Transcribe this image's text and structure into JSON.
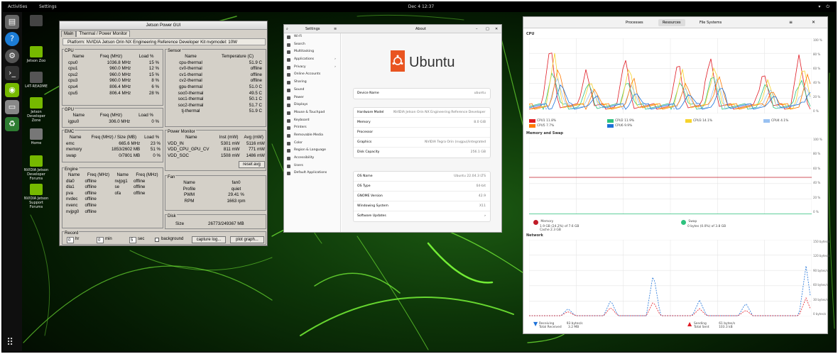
{
  "topbar": {
    "activities": "Activities",
    "app_name": "Settings",
    "clock": "Dec 4 12:37",
    "tray": "▾ ⏻"
  },
  "dock": {
    "items": [
      {
        "name": "files-icon",
        "color": "#666"
      },
      {
        "name": "help-icon",
        "color": "#1c7cd6"
      },
      {
        "name": "settings-icon",
        "color": "#555"
      },
      {
        "name": "terminal-icon",
        "color": "#333"
      },
      {
        "name": "nvidia-icon",
        "color": "#76b900"
      },
      {
        "name": "disk-icon",
        "color": "#888"
      },
      {
        "name": "trash-icon",
        "color": "#2e7d32"
      }
    ]
  },
  "desktop_icons": [
    {
      "label": "Jetson Zoo"
    },
    {
      "label": "L4T-README"
    },
    {
      "label": "Jetson Developer Zone"
    },
    {
      "label": "Home"
    },
    {
      "label": "NVIDIA Jetson Developer Forums"
    },
    {
      "label": "NVIDIA Jetson Support Forums"
    }
  ],
  "jpg": {
    "title": "Jetson Power GUI",
    "tabs": [
      "Main",
      "Thermal / Power Monitor"
    ],
    "platform": "Platform: NVIDIA Jetson Orin NX Engineering Reference Developer Kit     nvpmodel: 10W",
    "cpu": {
      "title": "CPU",
      "headers": [
        "Name",
        "Freq (MHz)",
        "Load %"
      ],
      "rows": [
        [
          "cpu0",
          "1036.8 MHz",
          "15 %"
        ],
        [
          "cpu1",
          "960.0 MHz",
          "12 %"
        ],
        [
          "cpu2",
          "960.0 MHz",
          "15 %"
        ],
        [
          "cpu3",
          "960.0 MHz",
          "8 %"
        ],
        [
          "cpu4",
          "806.4 MHz",
          "6 %"
        ],
        [
          "cpu5",
          "806.4 MHz",
          "28 %"
        ]
      ]
    },
    "gpu": {
      "title": "GPU",
      "headers": [
        "Name",
        "Freq (MHz)",
        "Load %"
      ],
      "rows": [
        [
          "igpu0",
          "306.0 MHz",
          "0 %"
        ]
      ]
    },
    "emc": {
      "title": "EMC",
      "headers": [
        "Name",
        "Freq (MHz) / Size (MB)",
        "Load %"
      ],
      "rows": [
        [
          "emc",
          "665.6 MHz",
          "23 %"
        ],
        [
          "memory",
          "1853/2602 MB",
          "51 %"
        ],
        [
          "swap",
          "0/7801 MB",
          "0 %"
        ]
      ]
    },
    "engine": {
      "title": "Engine",
      "headers": [
        "Name",
        "Freq (MHz)",
        "Name",
        "Freq (MHz)"
      ],
      "rows": [
        [
          "dla0",
          "offline",
          "nvjpg1",
          "offline"
        ],
        [
          "dla1",
          "offline",
          "se",
          "offline"
        ],
        [
          "pva",
          "offline",
          "ofa",
          "offline"
        ],
        [
          "nvdec",
          "offline",
          "",
          ""
        ],
        [
          "nvenc",
          "offline",
          "",
          ""
        ],
        [
          "nvjpg0",
          "offline",
          "",
          ""
        ]
      ]
    },
    "sensor": {
      "title": "Sensor",
      "headers": [
        "Name",
        "Temperature (C)"
      ],
      "rows": [
        [
          "cpu-thermal",
          "51.9 C"
        ],
        [
          "cv0-thermal",
          "offline"
        ],
        [
          "cv1-thermal",
          "offline"
        ],
        [
          "cv2-thermal",
          "offline"
        ],
        [
          "gpu-thermal",
          "51.0 C"
        ],
        [
          "soc0-thermal",
          "49.5 C"
        ],
        [
          "soc1-thermal",
          "50.1 C"
        ],
        [
          "soc2-thermal",
          "51.7 C"
        ],
        [
          "tj-thermal",
          "51.9 C"
        ]
      ]
    },
    "power": {
      "title": "Power Monitor",
      "headers": [
        "Name",
        "Inst (mW)",
        "Avg (mW)"
      ],
      "rows": [
        [
          "VDD_IN",
          "5301 mW",
          "5116 mW"
        ],
        [
          "VDD_CPU_GPU_CV",
          "811 mW",
          "771 mW"
        ],
        [
          "VDD_SOC",
          "1508 mW",
          "1486 mW"
        ]
      ],
      "reset": "reset avg"
    },
    "fan": {
      "title": "Fan",
      "headers": [
        "Name",
        "fan0"
      ],
      "rows": [
        [
          "Profile",
          "quiet"
        ],
        [
          "PWM",
          "29.41 %"
        ],
        [
          "RPM",
          "1663 rpm"
        ]
      ]
    },
    "disk": {
      "title": "Disk",
      "label": "Size",
      "value": "26773/249367 MB"
    },
    "record": {
      "title": "Record",
      "hr": "0",
      "hr_label": "hr",
      "min": "0",
      "min_label": "min",
      "sec": "5",
      "sec_label": "sec",
      "background": "background",
      "capture": "capture log...",
      "plot": "plot graph..."
    }
  },
  "settings": {
    "title": "Settings",
    "page_title": "About",
    "sidebar": [
      {
        "label": "Wi-Fi",
        "icon": "wifi-icon"
      },
      {
        "label": "Search",
        "icon": "search-icon"
      },
      {
        "label": "Multitasking",
        "icon": "multitasking-icon"
      },
      {
        "label": "Applications",
        "icon": "applications-icon"
      },
      {
        "label": "Privacy",
        "icon": "privacy-icon"
      },
      {
        "label": "Online Accounts",
        "icon": "online-accounts-icon"
      },
      {
        "label": "Sharing",
        "icon": "sharing-icon"
      },
      {
        "label": "Sound",
        "icon": "sound-icon"
      },
      {
        "label": "Power",
        "icon": "power-icon"
      },
      {
        "label": "Displays",
        "icon": "displays-icon"
      },
      {
        "label": "Mouse & Touchpad",
        "icon": "mouse-icon"
      },
      {
        "label": "Keyboard",
        "icon": "keyboard-icon"
      },
      {
        "label": "Printers",
        "icon": "printer-icon"
      },
      {
        "label": "Removable Media",
        "icon": "removable-media-icon"
      },
      {
        "label": "Color",
        "icon": "color-icon"
      },
      {
        "label": "Region & Language",
        "icon": "region-icon"
      },
      {
        "label": "Accessibility",
        "icon": "accessibility-icon"
      },
      {
        "label": "Users",
        "icon": "users-icon"
      },
      {
        "label": "Default Applications",
        "icon": "default-apps-icon"
      }
    ],
    "logo_text": "Ubuntu",
    "device_name": {
      "label": "Device Name",
      "value": "ubuntu"
    },
    "hardware": [
      {
        "label": "Hardware Model",
        "value": "NVIDIA Jetson Orin NX Engineering Reference Developer Kit"
      },
      {
        "label": "Memory",
        "value": "8.0 GiB"
      },
      {
        "label": "Processor",
        "value": ""
      },
      {
        "label": "Graphics",
        "value": "NVIDIA Tegra Orin (nvgpu)/integrated"
      },
      {
        "label": "Disk Capacity",
        "value": "256.1 GB"
      }
    ],
    "os": [
      {
        "label": "OS Name",
        "value": "Ubuntu 22.04.3 LTS"
      },
      {
        "label": "OS Type",
        "value": "64-bit"
      },
      {
        "label": "GNOME Version",
        "value": "42.9"
      },
      {
        "label": "Windowing System",
        "value": "X11"
      },
      {
        "label": "Software Updates",
        "value": ""
      }
    ]
  },
  "sysmon": {
    "tabs": [
      "Processes",
      "Resources",
      "File Systems"
    ],
    "cpu_title": "CPU",
    "mem_title": "Memory and Swap",
    "net_title": "Network",
    "cpu_ticks": [
      "100 %",
      "80 %",
      "60 %",
      "40 %",
      "20 %",
      "0 %"
    ],
    "mem_ticks": [
      "100 %",
      "80 %",
      "60 %",
      "40 %",
      "20 %",
      "0 %"
    ],
    "net_ticks": [
      "150 bytes/s",
      "120 bytes/s",
      "90 bytes/s",
      "60 bytes/s",
      "30 bytes/s",
      "0 bytes/s"
    ],
    "cpu_legend": [
      {
        "label": "CPU1  11.8%",
        "color": "#e01b24"
      },
      {
        "label": "CPU2  11.9%",
        "color": "#2ec27e"
      },
      {
        "label": "CPU3  14.1%",
        "color": "#f6d32d"
      },
      {
        "label": "CPU4   4.1%",
        "color": "#99c1f1"
      },
      {
        "label": "CPU5   7.7%",
        "color": "#ff7800"
      },
      {
        "label": "CPU6   9.9%",
        "color": "#1c71d8"
      }
    ],
    "memory": {
      "label": "Memory",
      "detail": "1.9 GB (24.2%) of 7.6 GB",
      "cache": "Cache 2.3 GB",
      "color": "#c01c28"
    },
    "swap": {
      "label": "Swap",
      "detail": "0 bytes (0.0%) of 3.8 GB",
      "color": "#2ec27e"
    },
    "receiving": {
      "label": "Receiving",
      "rate": "93 bytes/s",
      "total_label": "Total Received",
      "total": "3.2 MB",
      "color": "#1c71d8"
    },
    "sending": {
      "label": "Sending",
      "rate": "61 bytes/s",
      "total_label": "Total Sent",
      "total": "103.3 kB",
      "color": "#e01b24"
    }
  }
}
